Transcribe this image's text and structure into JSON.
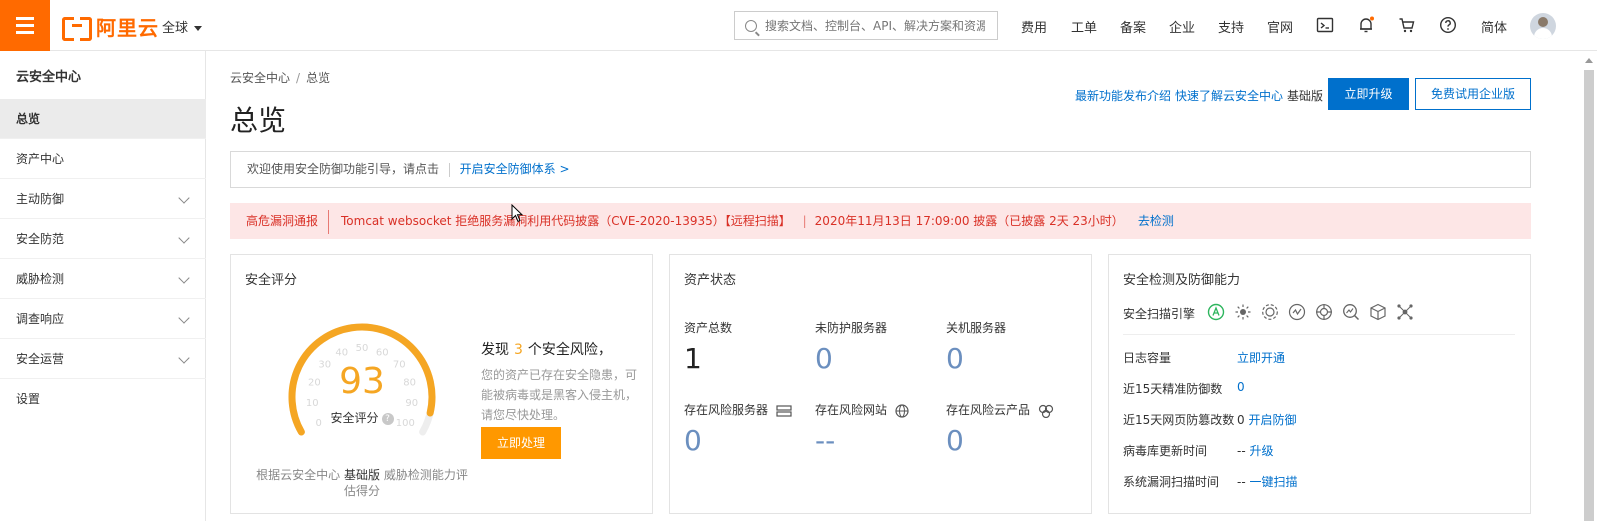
{
  "topbar": {
    "brand": "阿里云",
    "region": "全球",
    "search_placeholder": "搜索文档、控制台、API、解决方案和资源",
    "nav": [
      "费用",
      "工单",
      "备案",
      "企业",
      "支持",
      "官网"
    ],
    "lang": "简体",
    "icons": [
      "terminal-icon",
      "bell-icon",
      "cart-icon",
      "help-icon"
    ]
  },
  "sidebar": {
    "title": "云安全中心",
    "items": [
      {
        "label": "总览",
        "active": true,
        "expandable": false
      },
      {
        "label": "资产中心",
        "expandable": false
      },
      {
        "label": "主动防御",
        "expandable": true
      },
      {
        "label": "安全防范",
        "expandable": true
      },
      {
        "label": "威胁检测",
        "expandable": true
      },
      {
        "label": "调查响应",
        "expandable": true
      },
      {
        "label": "安全运营",
        "expandable": true
      },
      {
        "label": "设置",
        "expandable": false
      }
    ]
  },
  "main": {
    "breadcrumb": [
      "云安全中心",
      "总览"
    ],
    "breadcrumb_sep": "/",
    "title": "总览",
    "header_links": {
      "whats_new": "最新功能发布介绍",
      "quick_start": "快速了解云安全中心",
      "edition": "基础版"
    },
    "upgrade_button": "立即升级",
    "trial_button": "免费试用企业版",
    "guide": {
      "text": "欢迎使用安全防御功能引导，请点击",
      "link": "开启安全防御体系 >"
    },
    "alert": {
      "tag": "高危漏洞通报",
      "message": "Tomcat websocket 拒绝服务漏洞利用代码披露（CVE-2020-13935）【远程扫描】",
      "sep": "|",
      "time": "2020年11月13日 17:09:00 披露（已披露 2天 23小时）",
      "link": "去检测"
    },
    "score_card": {
      "title": "安全评分",
      "score": 93,
      "score_label": "安全评分",
      "help_glyph": "?",
      "gauge_ticks": [
        "0",
        "10",
        "20",
        "30",
        "40",
        "50",
        "60",
        "70",
        "80",
        "90",
        "100"
      ],
      "risk_prefix": "发现",
      "risk_count": 3,
      "risk_suffix": "个安全风险，",
      "risk_desc": "您的资产已存在安全隐患，可能被病毒或是黑客入侵主机，请您尽快处理。",
      "handle_button": "立即处理",
      "footer_prefix": "根据云安全中心",
      "footer_edition": "基础版",
      "footer_suffix": "威胁检测能力评估得分"
    },
    "asset_card": {
      "title": "资产状态",
      "stats": [
        {
          "label": "资产总数",
          "value": "1"
        },
        {
          "label": "未防护服务器",
          "value": "0"
        },
        {
          "label": "关机服务器",
          "value": "0"
        },
        {
          "label": "存在风险服务器",
          "value": "0"
        },
        {
          "label": "存在风险网站",
          "value": "--"
        },
        {
          "label": "存在风险云产品",
          "value": "0"
        }
      ]
    },
    "defense_card": {
      "title": "安全检测及防御能力",
      "engine_label": "安全扫描引擎",
      "engine_icons": [
        "shield-a-icon",
        "sun-icon",
        "virus-icon",
        "webshell-icon",
        "target-icon",
        "chart-search-icon",
        "cube-icon",
        "network-icon"
      ],
      "rows": [
        {
          "label": "日志容量",
          "value": "",
          "link": "立即开通"
        },
        {
          "label": "近15天精准防御数",
          "value": "",
          "link": "0"
        },
        {
          "label": "近15天网页防篡改数",
          "value": "0",
          "link": "开启防御"
        },
        {
          "label": "病毒库更新时间",
          "value": "--",
          "link": "升级"
        },
        {
          "label": "系统漏洞扫描时间",
          "value": "--",
          "link": "一键扫描"
        }
      ]
    }
  },
  "colors": {
    "brand": "#ff6a00",
    "primary": "#0070cc",
    "score": "#f5a623",
    "danger": "#d93026",
    "alert_bg": "#fde6e6"
  }
}
